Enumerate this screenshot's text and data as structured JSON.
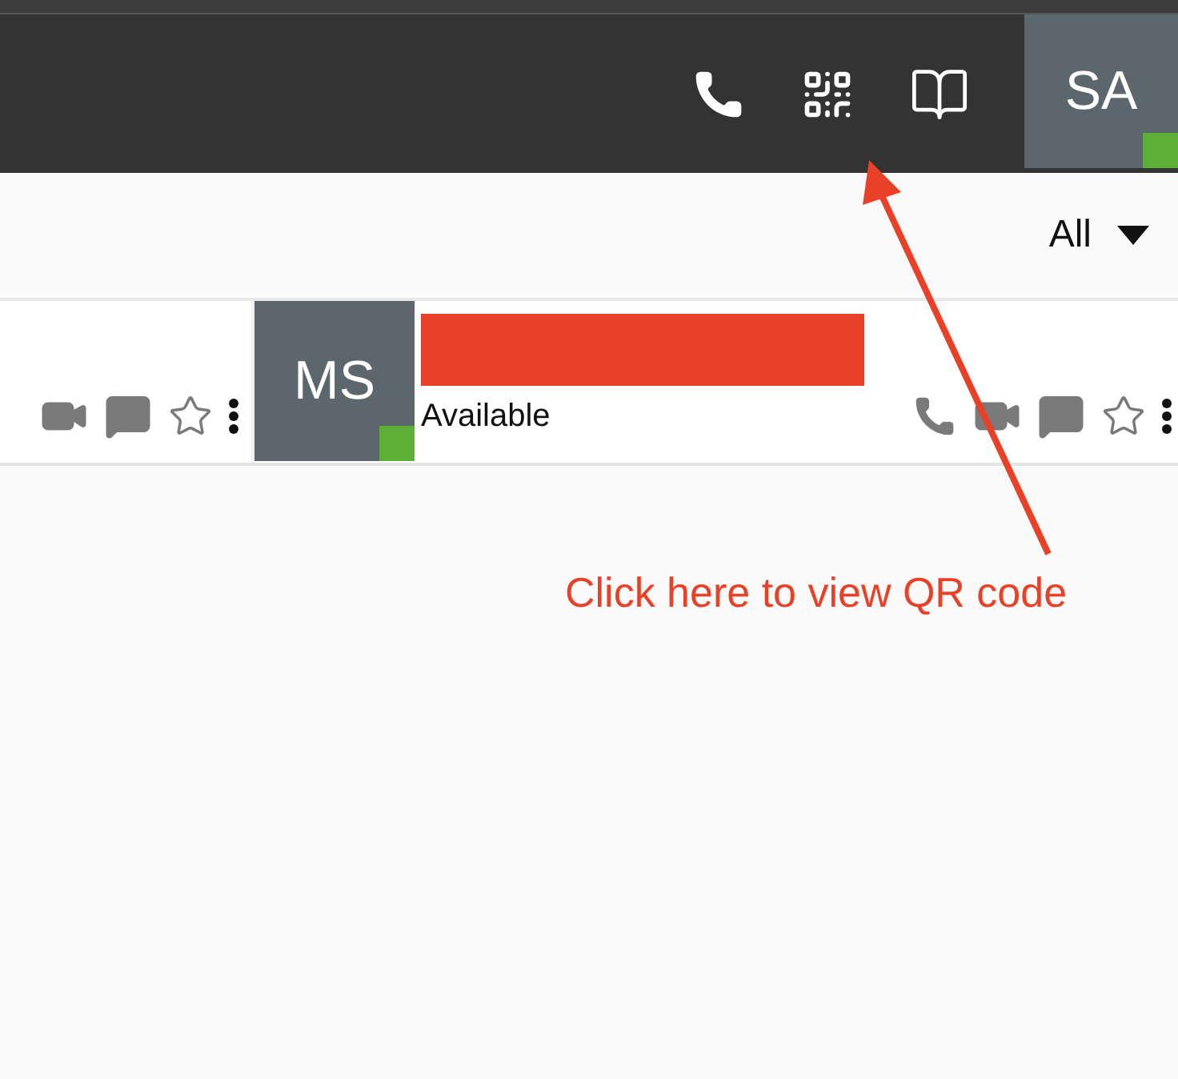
{
  "header": {
    "user": {
      "initials": "SA",
      "online": true
    }
  },
  "filter": {
    "value": "All"
  },
  "contacts": [
    {
      "kind": "partial"
    },
    {
      "kind": "full",
      "initials": "MS",
      "online": true,
      "name_redacted": true,
      "status": "Available"
    }
  ],
  "annotation": {
    "text": "Click here to view QR code"
  }
}
